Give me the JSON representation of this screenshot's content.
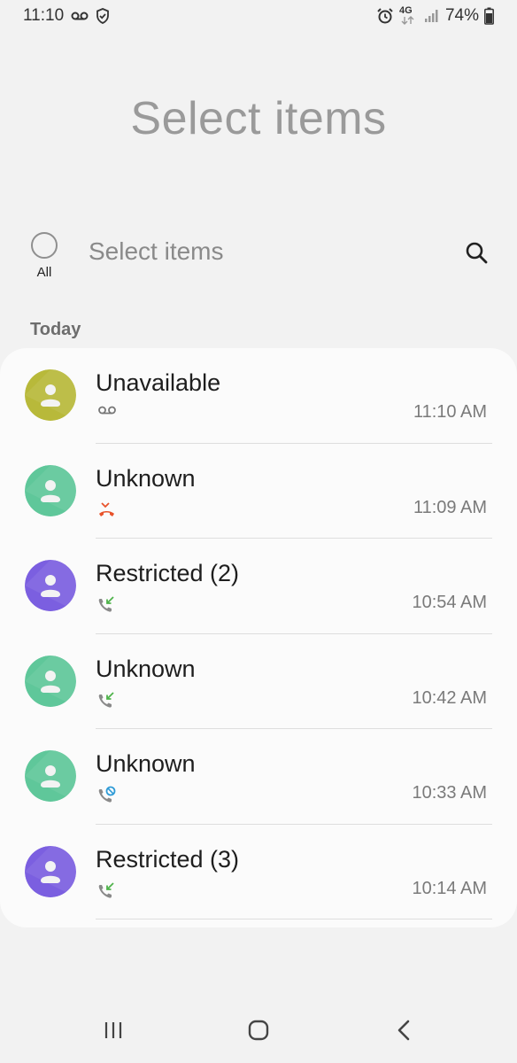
{
  "status_bar": {
    "time": "11:10",
    "battery": "74%",
    "network": "4G"
  },
  "title": "Select items",
  "select_header": {
    "all_label": "All",
    "text": "Select items"
  },
  "section_header": "Today",
  "calls": [
    {
      "name": "Unavailable",
      "time": "11:10 AM",
      "type": "voicemail",
      "avatar_color": "#b8b93a"
    },
    {
      "name": "Unknown",
      "time": "11:09 AM",
      "type": "missed",
      "avatar_color": "#5fc79a"
    },
    {
      "name": "Restricted (2)",
      "time": "10:54 AM",
      "type": "incoming",
      "avatar_color": "#7b5fe0"
    },
    {
      "name": "Unknown",
      "time": "10:42 AM",
      "type": "incoming",
      "avatar_color": "#5fc79a"
    },
    {
      "name": "Unknown",
      "time": "10:33 AM",
      "type": "blocked",
      "avatar_color": "#5fc79a"
    },
    {
      "name": "Restricted (3)",
      "time": "10:14 AM",
      "type": "incoming",
      "avatar_color": "#7b5fe0"
    }
  ],
  "colors": {
    "missed": "#e8532b",
    "incoming_arrow": "#4fb34b",
    "blocked": "#2f9bd6"
  }
}
